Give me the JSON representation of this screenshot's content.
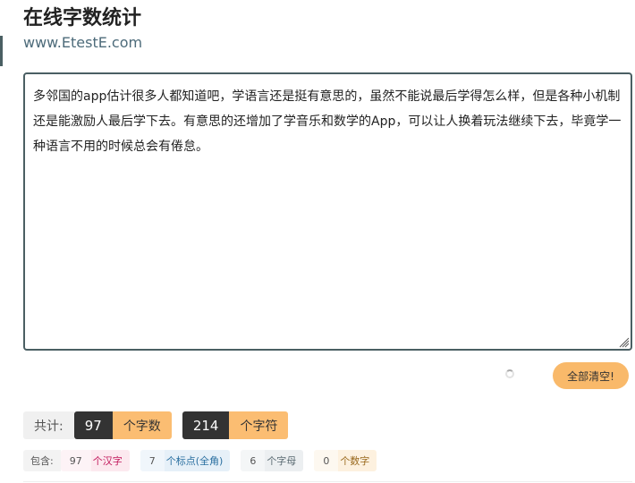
{
  "header": {
    "title": "在线字数统计",
    "url": "www.EtestE.com"
  },
  "editor": {
    "value": "多邻国的app估计很多人都知道吧，学语言还是挺有意思的，虽然不能说最后学得怎么样，但是各种小机制还是能激励人最后学下去。有意思的还增加了学音乐和数学的App，可以让人换着玩法继续下去，毕竟学一种语言不用的时候总会有倦怠。"
  },
  "actions": {
    "clear_label": "全部清空!"
  },
  "summary": {
    "label": "共计:",
    "word_count": "97",
    "word_unit": "个字数",
    "char_count": "214",
    "char_unit": "个字符"
  },
  "details": {
    "label": "包含:",
    "hanzi_count": "97",
    "hanzi_unit": "个汉字",
    "punct_count": "7",
    "punct_unit": "个标点(全角)",
    "letter_count": "6",
    "letter_unit": "个字母",
    "digit_count": "0",
    "digit_unit": "个数字"
  },
  "colors": {
    "accent": "#fbbd72",
    "dark": "#333333",
    "border": "#4a5f63"
  }
}
